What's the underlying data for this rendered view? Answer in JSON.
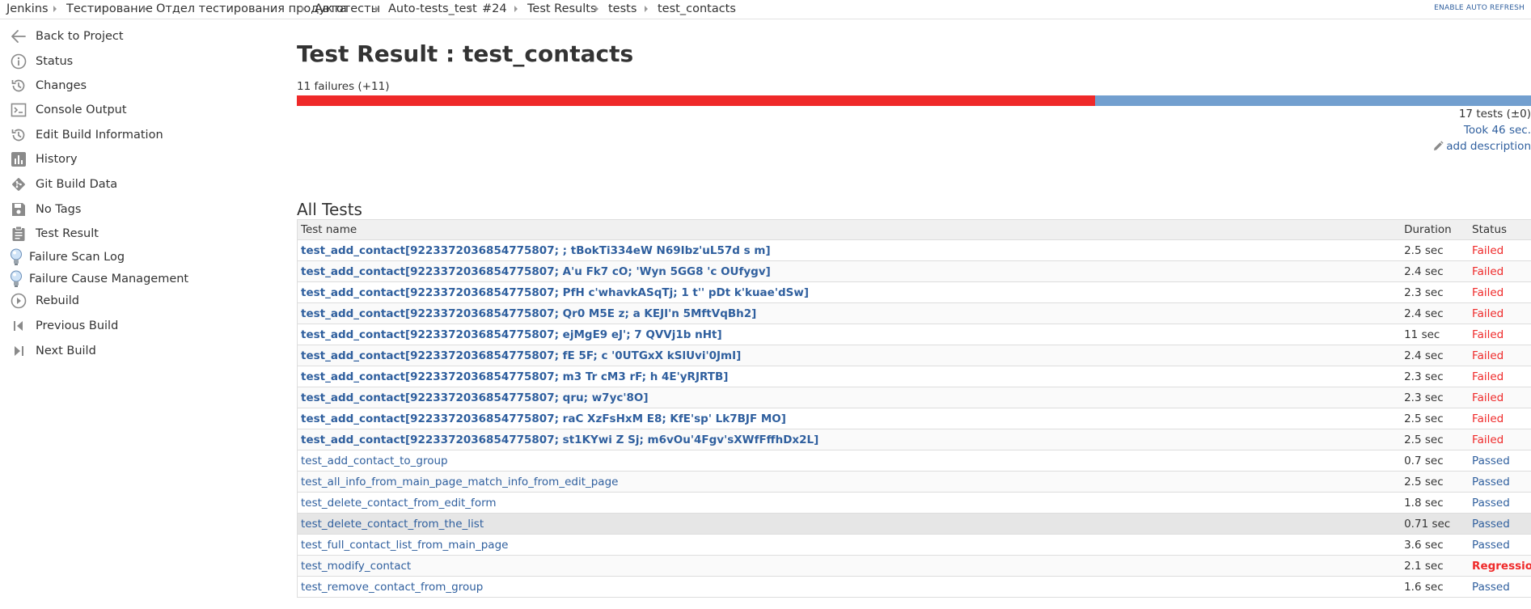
{
  "breadcrumbs": [
    "Jenkins",
    "Тестирование",
    "Отдел тестирования продукта",
    "Автотесты",
    "Auto-tests_test",
    "#24",
    "Test Results",
    "tests",
    "test_contacts"
  ],
  "auto_refresh": "ENABLE AUTO REFRESH",
  "sidebar": {
    "items": [
      {
        "label": "Back to Project",
        "icon": "arrow-left-icon"
      },
      {
        "label": "Status",
        "icon": "info-icon"
      },
      {
        "label": "Changes",
        "icon": "history-icon"
      },
      {
        "label": "Console Output",
        "icon": "terminal-icon"
      },
      {
        "label": "Edit Build Information",
        "icon": "history-icon"
      },
      {
        "label": "History",
        "icon": "bar-chart-icon"
      },
      {
        "label": "Git Build Data",
        "icon": "git-icon"
      },
      {
        "label": "No Tags",
        "icon": "save-icon"
      },
      {
        "label": "Test Result",
        "icon": "clipboard-icon"
      },
      {
        "label": "Failure Scan Log",
        "icon": "lightbulb-icon"
      },
      {
        "label": "Failure Cause Management",
        "icon": "lightbulb-icon"
      },
      {
        "label": "Rebuild",
        "icon": "play-circle-icon"
      },
      {
        "label": "Previous Build",
        "icon": "previous-icon"
      },
      {
        "label": "Next Build",
        "icon": "next-icon"
      }
    ]
  },
  "main": {
    "title": "Test Result : test_contacts",
    "failures": "11 failures (+11)",
    "failed_count": 11,
    "total_count": 17,
    "tests_total": "17 tests (±0)",
    "took": "Took 46 sec.",
    "add_description": "add description",
    "section_heading": "All Tests",
    "table": {
      "headers": {
        "name": "Test name",
        "duration": "Duration",
        "status": "Status"
      },
      "rows": [
        {
          "name": "test_add_contact[9223372036854775807; ; tBokTi334eW N69Ibz'uL57d s m]",
          "duration": "2.5 sec",
          "status": "Failed"
        },
        {
          "name": "test_add_contact[9223372036854775807; A'u Fk7 cO; 'Wyn 5GG8 'c OUfygv]",
          "duration": "2.4 sec",
          "status": "Failed"
        },
        {
          "name": "test_add_contact[9223372036854775807; PfH c'whavkASqTj; 1 t'' pDt k'kuae'dSw]",
          "duration": "2.3 sec",
          "status": "Failed"
        },
        {
          "name": "test_add_contact[9223372036854775807; Qr0 M5E z; a KEJI'n 5MftVqBh2]",
          "duration": "2.4 sec",
          "status": "Failed"
        },
        {
          "name": "test_add_contact[9223372036854775807; ejMgE9 eJ'; 7 QVVj1b nHt]",
          "duration": "11 sec",
          "status": "Failed"
        },
        {
          "name": "test_add_contact[9223372036854775807; fE 5F; c '0UTGxX kSlUvi'0JmI]",
          "duration": "2.4 sec",
          "status": "Failed"
        },
        {
          "name": "test_add_contact[9223372036854775807; m3 Tr cM3 rF; h 4E'yRJRTB]",
          "duration": "2.3 sec",
          "status": "Failed"
        },
        {
          "name": "test_add_contact[9223372036854775807; qru; w7yc'8O]",
          "duration": "2.3 sec",
          "status": "Failed"
        },
        {
          "name": "test_add_contact[9223372036854775807; raC XzFsHxM E8; KfE'sp' Lk7BJF MO]",
          "duration": "2.5 sec",
          "status": "Failed"
        },
        {
          "name": "test_add_contact[9223372036854775807; st1KYwi Z Sj; m6vOu'4Fgv'sXWfFffhDx2L]",
          "duration": "2.5 sec",
          "status": "Failed"
        },
        {
          "name": "test_add_contact_to_group",
          "duration": "0.7 sec",
          "status": "Passed"
        },
        {
          "name": "test_all_info_from_main_page_match_info_from_edit_page",
          "duration": "2.5 sec",
          "status": "Passed"
        },
        {
          "name": "test_delete_contact_from_edit_form",
          "duration": "1.8 sec",
          "status": "Passed"
        },
        {
          "name": "test_delete_contact_from_the_list",
          "duration": "0.71 sec",
          "status": "Passed"
        },
        {
          "name": "test_full_contact_list_from_main_page",
          "duration": "3.6 sec",
          "status": "Passed"
        },
        {
          "name": "test_modify_contact",
          "duration": "2.1 sec",
          "status": "Regression"
        },
        {
          "name": "test_remove_contact_from_group",
          "duration": "1.6 sec",
          "status": "Passed"
        }
      ]
    }
  },
  "colors": {
    "fail": "#ef2929",
    "pass": "#729fcf",
    "link": "#2f5f9e"
  }
}
